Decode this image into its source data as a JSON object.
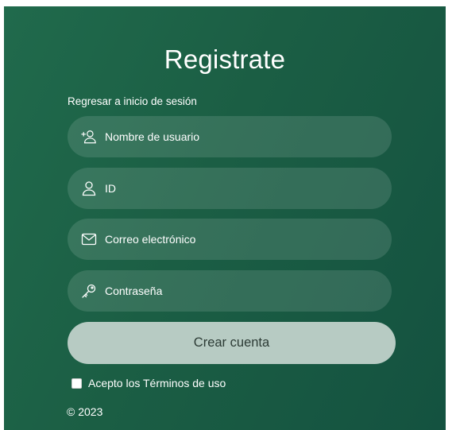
{
  "form": {
    "title": "Registrate",
    "back_link": "Regresar a inicio de sesión",
    "fields": [
      {
        "name": "username",
        "placeholder": "Nombre de usuario",
        "icon": "add-user-icon"
      },
      {
        "name": "id",
        "placeholder": "ID",
        "icon": "user-icon"
      },
      {
        "name": "email",
        "placeholder": "Correo electrónico",
        "icon": "mail-icon"
      },
      {
        "name": "password",
        "placeholder": "Contraseña",
        "icon": "key-icon"
      }
    ],
    "submit_label": "Crear cuenta",
    "terms_label": "Acepto los Términos de uso",
    "terms_checked": false,
    "copyright": "© 2023"
  },
  "colors": {
    "panel_green": "#1b5e44",
    "button_bg": "#b7cbc3",
    "text": "#ffffff"
  }
}
